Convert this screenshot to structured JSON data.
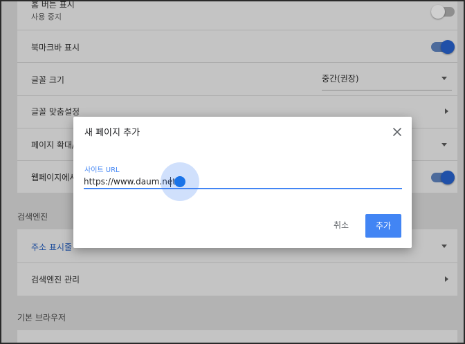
{
  "settings": {
    "home_button": {
      "label": "홈 버튼 표시",
      "sub": "사용 중지",
      "state": "off"
    },
    "bookmarks_bar": {
      "label": "북마크바 표시",
      "state": "on"
    },
    "font_size": {
      "label": "글꼴 크기",
      "value": "중간(권장)"
    },
    "customize_fonts": {
      "label": "글꼴 맞춤설정"
    },
    "page_zoom": {
      "label": "페이지 확대/"
    },
    "web_page": {
      "label": "웹페이지에서",
      "state": "on"
    }
  },
  "search_engine": {
    "heading": "검색엔진",
    "address_bar_label": "주소 표시줄",
    "manage_label": "검색엔진 관리"
  },
  "default_browser": {
    "heading": "기본 브라우저"
  },
  "dialog": {
    "title": "새 페이지 추가",
    "field_label": "사이트 URL",
    "field_value": "https://www.daum.net",
    "cancel_label": "취소",
    "add_label": "추가"
  },
  "colors": {
    "accent": "#4285f4",
    "overlay": "#b3b3b3",
    "toggle_on": "#2050a8"
  },
  "icons": [
    "close-icon",
    "dropdown-caret-icon",
    "chevron-right-icon"
  ]
}
